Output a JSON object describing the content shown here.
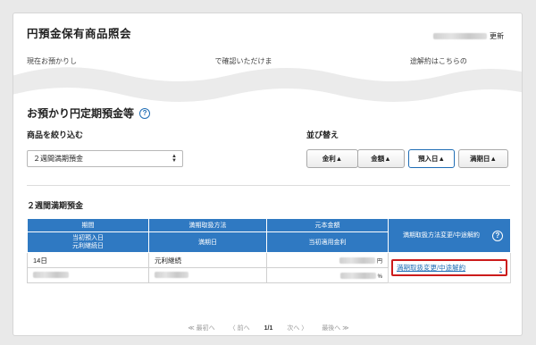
{
  "page": {
    "title": "円預金保有商品照会",
    "updated_label": "更新",
    "intro_visible_start": "現在お預かりし",
    "intro_visible_mid": "で確認いただけま",
    "intro_visible_end": "途解約はこちらの"
  },
  "section": {
    "title": "お預かり円定期預金等",
    "help": "?"
  },
  "filter": {
    "label": "商品を絞り込む",
    "selected": "２週間満期預金"
  },
  "sort": {
    "label": "並び替え",
    "buttons": [
      "金利▲",
      "金額▲",
      "預入日▲",
      "満期日▲"
    ],
    "active_index": 2
  },
  "product": {
    "title": "２週間満期預金"
  },
  "table": {
    "headers": {
      "period": "期間",
      "initial_deposit_date": "当初預入日",
      "renewal_date": "元利継続日",
      "maturity_method": "満期取扱方法",
      "maturity_date": "満期日",
      "principal": "元本金額",
      "initial_rate": "当初適用金利",
      "change_action": "満期取扱方法変更/中途解約",
      "help": "?"
    },
    "row": {
      "period": "14日",
      "maturity_method": "元利継続",
      "yen_unit": "円",
      "percent_unit": "%",
      "link_label": "満期取扱変更/中途解約",
      "chevron": "›"
    }
  },
  "pager": {
    "first": "≪ 最初へ",
    "prev": "〈 前へ",
    "current": "1/1",
    "next": "次へ 〉",
    "last": "最後へ ≫"
  },
  "colors": {
    "header_blue": "#2f79c2",
    "link_blue": "#1f6db5",
    "highlight_red": "#cc1b1b"
  }
}
